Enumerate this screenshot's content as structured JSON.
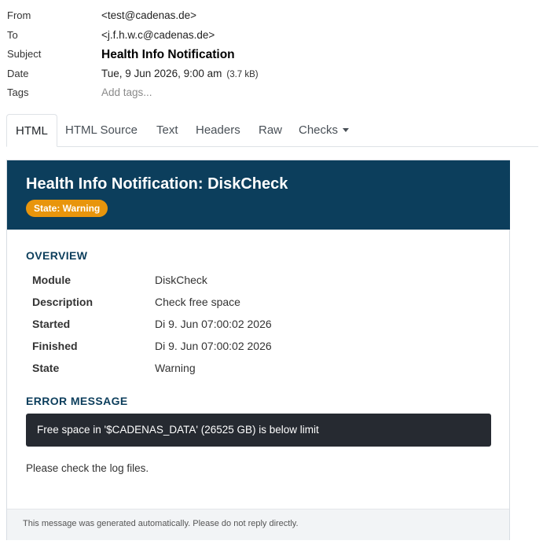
{
  "header": {
    "from_label": "From",
    "from_value": "<test@cadenas.de>",
    "to_label": "To",
    "to_value": "<j.f.h.w.c@cadenas.de>",
    "subject_label": "Subject",
    "subject_value": "Health Info Notification",
    "date_label": "Date",
    "date_value": "Tue, 9 Jun 2026, 9:00 am",
    "size_value": "(3.7 kB)",
    "tags_label": "Tags",
    "tags_placeholder": "Add tags..."
  },
  "tabs": {
    "html": "HTML",
    "source": "HTML Source",
    "text": "Text",
    "headers": "Headers",
    "raw": "Raw",
    "checks": "Checks"
  },
  "mail": {
    "title": "Health Info Notification: DiskCheck",
    "badge": "State: Warning",
    "overview_heading": "OVERVIEW",
    "rows": [
      {
        "key": "Module",
        "value": "DiskCheck"
      },
      {
        "key": "Description",
        "value": "Check free space"
      },
      {
        "key": "Started",
        "value": "Di 9. Jun 07:00:02 2026"
      },
      {
        "key": "Finished",
        "value": "Di 9. Jun 07:00:02 2026"
      },
      {
        "key": "State",
        "value": "Warning"
      }
    ],
    "error_heading": "ERROR MESSAGE",
    "error_text": "Free space in '$CADENAS_DATA' (26525 GB) is below limit",
    "note": "Please check the log files.",
    "footer": "This message was generated automatically. Please do not reply directly."
  },
  "colors": {
    "banner": "#0c3e5c",
    "badge": "#e8950c",
    "error_box": "#262a31"
  }
}
